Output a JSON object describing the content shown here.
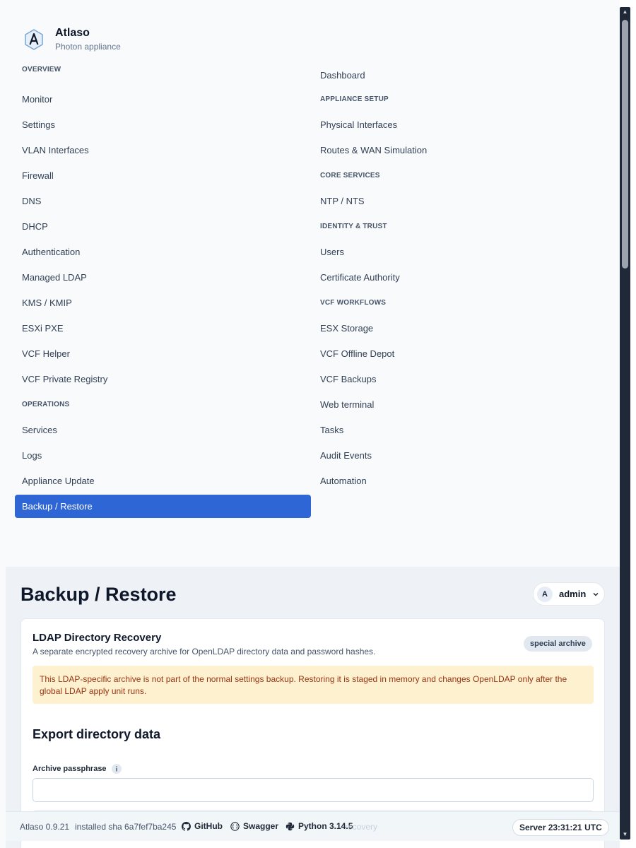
{
  "brand": {
    "name": "Atlaso",
    "subtitle": "Photon appliance"
  },
  "nav": {
    "overview_heading": "OVERVIEW",
    "dashboard": "Dashboard",
    "monitor": "Monitor",
    "appliance_setup_heading": "APPLIANCE SETUP",
    "settings": "Settings",
    "physical_interfaces": "Physical Interfaces",
    "vlan_interfaces": "VLAN Interfaces",
    "routes_wan": "Routes & WAN Simulation",
    "firewall": "Firewall",
    "core_services_heading": "CORE SERVICES",
    "dns": "DNS",
    "ntp_nts": "NTP / NTS",
    "dhcp": "DHCP",
    "identity_trust_heading": "IDENTITY & TRUST",
    "authentication": "Authentication",
    "users": "Users",
    "managed_ldap": "Managed LDAP",
    "certificate_authority": "Certificate Authority",
    "kms_kmip": "KMS / KMIP",
    "vcf_workflows_heading": "VCF WORKFLOWS",
    "esxi_pxe": "ESXi PXE",
    "esx_storage": "ESX Storage",
    "vcf_helper": "VCF Helper",
    "vcf_offline_depot": "VCF Offline Depot",
    "vcf_private_registry": "VCF Private Registry",
    "vcf_backups": "VCF Backups",
    "operations_heading": "OPERATIONS",
    "web_terminal": "Web terminal",
    "services": "Services",
    "tasks": "Tasks",
    "logs": "Logs",
    "audit_events": "Audit Events",
    "appliance_update": "Appliance Update",
    "automation": "Automation",
    "backup_restore": "Backup / Restore"
  },
  "header": {
    "page_title": "Backup / Restore",
    "user_initial": "A",
    "user_name": "admin"
  },
  "card": {
    "title": "LDAP Directory Recovery",
    "description": "A separate encrypted recovery archive for OpenLDAP directory data and password hashes.",
    "badge": "special archive",
    "alert": "This LDAP-specific archive is not part of the normal settings backup. Restoring it is staged in memory and changes OpenLDAP only after the global LDAP apply unit runs.",
    "section_title": "Export directory data",
    "passphrase_label": "Archive passphrase",
    "passphrase_value": ""
  },
  "footer": {
    "version": "Atlaso 0.9.21",
    "sha": "installed sha 6a7fef7ba245",
    "github": "GitHub",
    "swagger": "Swagger",
    "python": "Python 3.14.5",
    "obscured_text": "recovery",
    "server_time": "Server 23:31:21 UTC"
  },
  "colors": {
    "accent": "#2f66d6",
    "alert_bg": "#fdf1cf",
    "alert_text": "#9a3412"
  }
}
